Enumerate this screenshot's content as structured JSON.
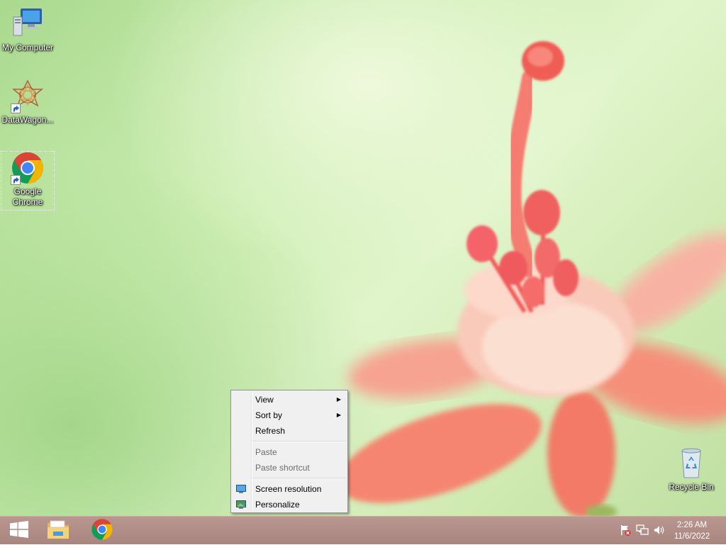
{
  "desktop": {
    "icons": [
      {
        "label": "My Computer",
        "icon": "computer-icon"
      },
      {
        "label": "DataWagon...",
        "icon": "datawagon-icon"
      },
      {
        "label": "Google Chrome",
        "icon": "chrome-icon"
      },
      {
        "label": "Recycle Bin",
        "icon": "recycle-bin-icon"
      }
    ]
  },
  "context_menu": {
    "items": [
      {
        "label": "View",
        "has_submenu": true
      },
      {
        "label": "Sort by",
        "has_submenu": true
      },
      {
        "label": "Refresh"
      },
      {
        "label": "Paste",
        "disabled": true
      },
      {
        "label": "Paste shortcut",
        "disabled": true
      },
      {
        "label": "Screen resolution",
        "icon": "screen-resolution-icon"
      },
      {
        "label": "Personalize",
        "icon": "personalize-icon"
      }
    ],
    "submenu_arrow": "▶"
  },
  "taskbar": {
    "start_icon": "windows-start-icon",
    "pinned": [
      "file-explorer-icon",
      "chrome-icon"
    ],
    "tray": [
      "action-center-flag-icon",
      "network-icon",
      "volume-icon"
    ],
    "clock_time": "2:26 AM",
    "clock_date": "11/6/2022"
  },
  "colors": {
    "taskbar": "#b0908a",
    "menu_bg": "#f0f0f0",
    "chrome_red": "#db4437",
    "chrome_green": "#0f9d58",
    "chrome_yellow": "#f4b400",
    "chrome_blue": "#4285f4"
  }
}
